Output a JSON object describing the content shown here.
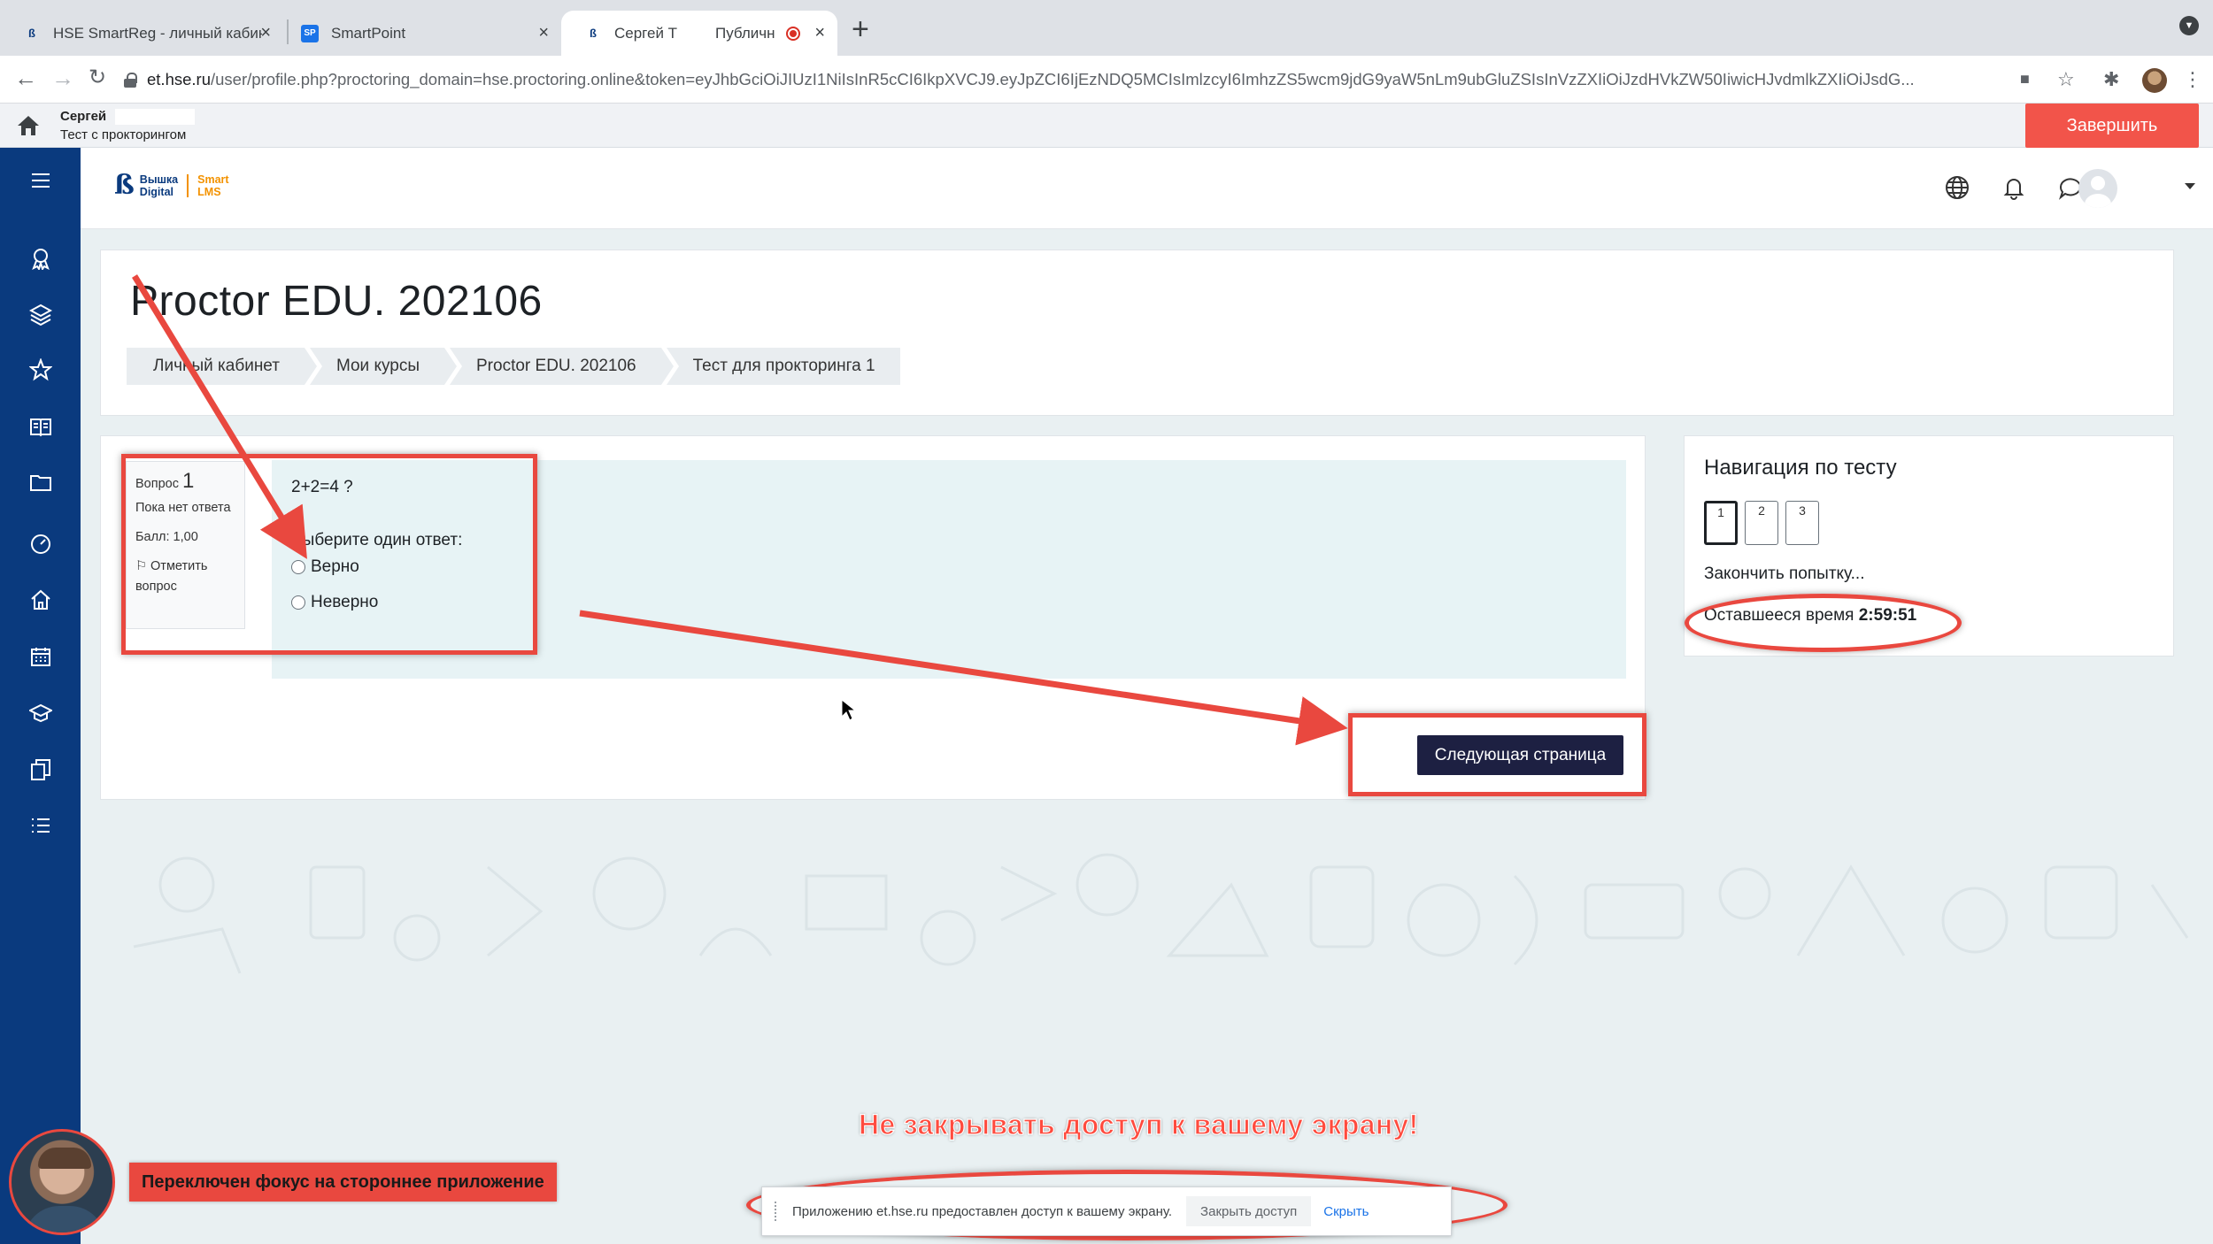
{
  "browser": {
    "tabs": [
      {
        "title": "HSE SmartReg - личный кабин",
        "active": false
      },
      {
        "title": "SmartPoint",
        "active": false
      },
      {
        "title": "Сергей Т",
        "active": true
      },
      {
        "title": "Публичн",
        "active": false
      }
    ],
    "url_host": "et.hse.ru",
    "url_rest": "/user/profile.php?proctoring_domain=hse.proctoring.online&token=eyJhbGciOiJIUzI1NiIsInR5cCI6IkpXVCJ9.eyJpZCI6IjEzNDQ5MCIsImlzcyI6ImhzZS5wcm9jdG9yaW5nLm9ubGluZSIsInVzZXIiOiJzdHVkZW50IiwicHJvdmlkZXIiOiJsdG..."
  },
  "proctor_bar": {
    "user_name": "Сергей",
    "test_name": "Тест с прокторингом",
    "finish_label": "Завершить"
  },
  "lms": {
    "logo_line1": "Вышка",
    "logo_line2": "Digital",
    "logo_smart1": "Smart",
    "logo_smart2": "LMS"
  },
  "page": {
    "course_title": "Proctor EDU. 202106",
    "breadcrumb": [
      "Личный кабинет",
      "Мои курсы",
      "Proctor EDU. 202106",
      "Тест для прокторинга 1"
    ]
  },
  "question": {
    "label": "Вопрос",
    "number": "1",
    "status": "Пока нет ответа",
    "score": "Балл: 1,00",
    "flag_label": "Отметить вопрос",
    "text": "2+2=4 ?",
    "prompt": "Выберите один ответ:",
    "answers": [
      "Верно",
      "Неверно"
    ],
    "next_label": "Следующая страница"
  },
  "quiz_nav": {
    "title": "Навигация по тесту",
    "buttons": [
      "1",
      "2",
      "3"
    ],
    "finish_link": "Закончить попытку...",
    "time_label": "Оставшееся время",
    "time_value": "2:59:51"
  },
  "annotations": {
    "warning": "Не закрывать доступ к вашему экрану!",
    "focus_warning": "Переключен фокус на стороннее приложение"
  },
  "share_bar": {
    "message": "Приложению et.hse.ru предоставлен доступ к вашему экрану.",
    "stop_label": "Закрыть доступ",
    "hide_label": "Скрыть"
  },
  "colors": {
    "drawer": "#0a3a7e",
    "accent_red": "#e9483f",
    "finish_button": "#f2544a",
    "next_button": "#1d2042",
    "brand_orange": "#f39200"
  }
}
